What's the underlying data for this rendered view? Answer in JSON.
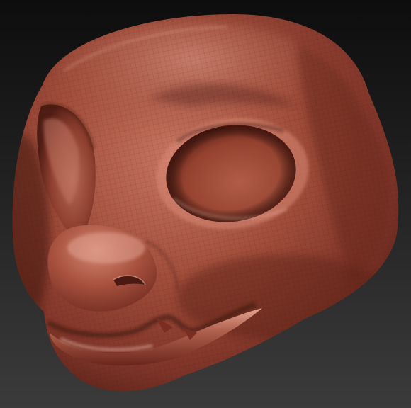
{
  "scene": {
    "subject": "sculpted-creature-head",
    "background_colors": {
      "top": "#0d0d0d",
      "bottom": "#3b3b3b"
    },
    "material_colors": {
      "base": "#9a4636",
      "light": "#c77562",
      "highlight": "#e7b3a2",
      "shadow": "#4e1c15",
      "deep_shadow": "#30100c"
    },
    "wireframe_visible": true
  }
}
